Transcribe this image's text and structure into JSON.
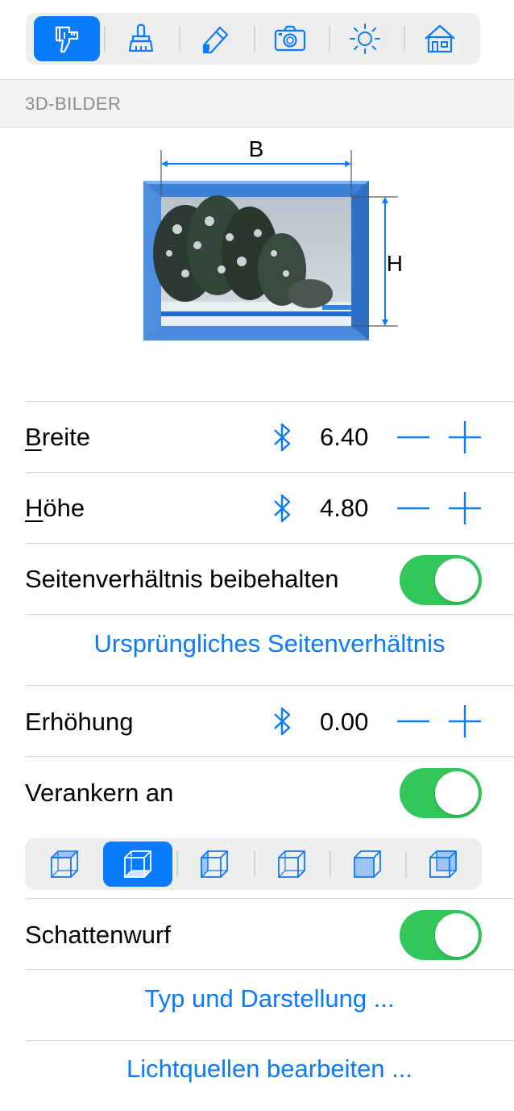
{
  "toolbar": {
    "tabs": [
      {
        "icon": "caliper-ruler-icon",
        "active": true
      },
      {
        "icon": "brush-icon",
        "active": false
      },
      {
        "icon": "pencil-eraser-icon",
        "active": false
      },
      {
        "icon": "camera-icon",
        "active": false
      },
      {
        "icon": "sun-icon",
        "active": false
      },
      {
        "icon": "house-icon",
        "active": false
      }
    ]
  },
  "section": {
    "title": "3D-BILDER"
  },
  "diagram": {
    "width_label": "B",
    "height_label": "H"
  },
  "rows": {
    "breite": {
      "label_first": "B",
      "label_rest": "reite",
      "value": "6.40"
    },
    "hoehe": {
      "label_first": "H",
      "label_rest": "öhe",
      "value": "4.80"
    },
    "aspect": {
      "label": "Seitenverhältnis beibehalten",
      "on": true
    },
    "original_aspect": {
      "label": "Ursprüngliches Seitenverhältnis"
    },
    "erhoehung": {
      "label": "Erhöhung",
      "value": "0.00"
    },
    "verankern": {
      "label": "Verankern an",
      "on": true
    },
    "schatten": {
      "label": "Schattenwurf",
      "on": true
    },
    "typ": {
      "label": "Typ und Darstellung ..."
    },
    "licht": {
      "label": "Lichtquellen bearbeiten ..."
    }
  },
  "anchor": {
    "options": [
      "anchor-top-icon",
      "anchor-bottom-icon",
      "anchor-left-icon",
      "anchor-front-icon",
      "anchor-back-icon",
      "anchor-right-icon"
    ],
    "selected_index": 1
  },
  "colors": {
    "accent": "#0a7aff",
    "toggle_on": "#34c759"
  }
}
